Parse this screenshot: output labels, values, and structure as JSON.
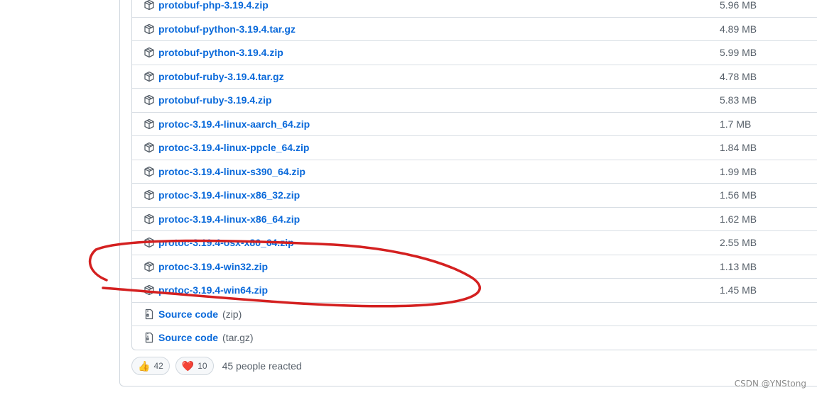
{
  "assets": [
    {
      "name": "protobuf-php-3.19.4.zip",
      "size": "5.96 MB"
    },
    {
      "name": "protobuf-python-3.19.4.tar.gz",
      "size": "4.89 MB"
    },
    {
      "name": "protobuf-python-3.19.4.zip",
      "size": "5.99 MB"
    },
    {
      "name": "protobuf-ruby-3.19.4.tar.gz",
      "size": "4.78 MB"
    },
    {
      "name": "protobuf-ruby-3.19.4.zip",
      "size": "5.83 MB"
    },
    {
      "name": "protoc-3.19.4-linux-aarch_64.zip",
      "size": "1.7 MB"
    },
    {
      "name": "protoc-3.19.4-linux-ppcle_64.zip",
      "size": "1.84 MB"
    },
    {
      "name": "protoc-3.19.4-linux-s390_64.zip",
      "size": "1.99 MB"
    },
    {
      "name": "protoc-3.19.4-linux-x86_32.zip",
      "size": "1.56 MB"
    },
    {
      "name": "protoc-3.19.4-linux-x86_64.zip",
      "size": "1.62 MB"
    },
    {
      "name": "protoc-3.19.4-osx-x86_64.zip",
      "size": "2.55 MB"
    },
    {
      "name": "protoc-3.19.4-win32.zip",
      "size": "1.13 MB"
    },
    {
      "name": "protoc-3.19.4-win64.zip",
      "size": "1.45 MB"
    }
  ],
  "source_code": [
    {
      "label": "Source code",
      "format": "(zip)"
    },
    {
      "label": "Source code",
      "format": "(tar.gz)"
    }
  ],
  "reactions": {
    "thumbs_up": {
      "emoji": "👍",
      "count": "42",
      "icon": "thumbs-up-icon"
    },
    "heart": {
      "emoji": "❤️",
      "count": "10",
      "icon": "heart-icon"
    },
    "summary": "45 people reacted"
  },
  "icons": {
    "asset": "package-icon",
    "source": "file-zip-icon"
  },
  "colors": {
    "link": "#0969da",
    "muted": "#57606a",
    "border": "#d0d7de",
    "annotation": "#d42020"
  },
  "watermark": "CSDN @YNStong"
}
